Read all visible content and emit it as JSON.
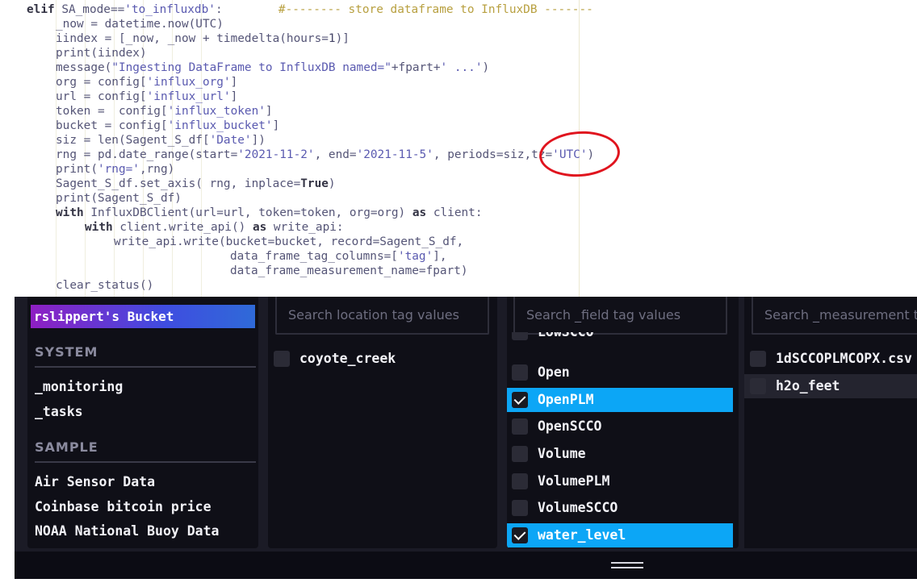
{
  "code": {
    "lines": [
      {
        "indent": 0,
        "parts": [
          {
            "t": "elif",
            "c": "kw"
          },
          {
            "t": " SA_mode==",
            "c": ""
          },
          {
            "t": "'to_influxdb'",
            "c": "str"
          },
          {
            "t": ":        ",
            "c": ""
          },
          {
            "t": "#-------- store dataframe to InfluxDB -------",
            "c": "cmt"
          }
        ]
      },
      {
        "indent": 1,
        "parts": [
          {
            "t": "_now = datetime.now(UTC)",
            "c": ""
          }
        ]
      },
      {
        "indent": 1,
        "parts": [
          {
            "t": "iindex = [_now, _now + timedelta(hours=",
            "c": ""
          },
          {
            "t": "1",
            "c": "num"
          },
          {
            "t": ")]",
            "c": ""
          }
        ]
      },
      {
        "indent": 1,
        "parts": [
          {
            "t": "print(iindex)",
            "c": ""
          }
        ]
      },
      {
        "indent": 1,
        "parts": [
          {
            "t": "message(",
            "c": ""
          },
          {
            "t": "\"Ingesting DataFrame to InfluxDB named=\"",
            "c": "str"
          },
          {
            "t": "+fpart+",
            "c": ""
          },
          {
            "t": "' ...'",
            "c": "str"
          },
          {
            "t": ")",
            "c": ""
          }
        ]
      },
      {
        "indent": 1,
        "parts": [
          {
            "t": "org = config[",
            "c": ""
          },
          {
            "t": "'influx_org'",
            "c": "str"
          },
          {
            "t": "]",
            "c": ""
          }
        ]
      },
      {
        "indent": 1,
        "parts": [
          {
            "t": "url = config[",
            "c": ""
          },
          {
            "t": "'influx_url'",
            "c": "str"
          },
          {
            "t": "]",
            "c": ""
          }
        ]
      },
      {
        "indent": 1,
        "parts": [
          {
            "t": "token =  config[",
            "c": ""
          },
          {
            "t": "'influx_token'",
            "c": "str"
          },
          {
            "t": "]",
            "c": ""
          }
        ]
      },
      {
        "indent": 1,
        "parts": [
          {
            "t": "bucket = config[",
            "c": ""
          },
          {
            "t": "'influx_bucket'",
            "c": "str"
          },
          {
            "t": "]",
            "c": ""
          }
        ]
      },
      {
        "indent": 1,
        "parts": [
          {
            "t": "siz = len(Sagent_S_df[",
            "c": ""
          },
          {
            "t": "'Date'",
            "c": "str"
          },
          {
            "t": "])",
            "c": ""
          }
        ]
      },
      {
        "indent": 1,
        "parts": [
          {
            "t": "rng = pd.date_range(start=",
            "c": ""
          },
          {
            "t": "'2021-11-2'",
            "c": "str"
          },
          {
            "t": ", end=",
            "c": ""
          },
          {
            "t": "'2021-11-5'",
            "c": "str"
          },
          {
            "t": ", periods=siz,tz=",
            "c": ""
          },
          {
            "t": "'UTC'",
            "c": "str"
          },
          {
            "t": ")",
            "c": ""
          }
        ]
      },
      {
        "indent": 1,
        "parts": [
          {
            "t": "print(",
            "c": ""
          },
          {
            "t": "'rng='",
            "c": "str"
          },
          {
            "t": ",rng)",
            "c": ""
          }
        ]
      },
      {
        "indent": 1,
        "parts": [
          {
            "t": "Sagent_S_df.set_axis( rng, inplace=",
            "c": ""
          },
          {
            "t": "True",
            "c": "kw"
          },
          {
            "t": ")",
            "c": ""
          }
        ]
      },
      {
        "indent": 1,
        "parts": [
          {
            "t": "print(Sagent_S_df)",
            "c": ""
          }
        ]
      },
      {
        "indent": 1,
        "parts": [
          {
            "t": "with",
            "c": "kw"
          },
          {
            "t": " InfluxDBClient(url=url, token=token, org=org) ",
            "c": ""
          },
          {
            "t": "as",
            "c": "kw"
          },
          {
            "t": " client:",
            "c": ""
          }
        ]
      },
      {
        "indent": 2,
        "parts": [
          {
            "t": "with",
            "c": "kw"
          },
          {
            "t": " client.write_api() ",
            "c": ""
          },
          {
            "t": "as",
            "c": "kw"
          },
          {
            "t": " write_api:",
            "c": ""
          }
        ]
      },
      {
        "indent": 3,
        "parts": [
          {
            "t": "write_api.write(bucket=bucket, record=Sagent_S_df,",
            "c": ""
          }
        ]
      },
      {
        "indent": 7,
        "parts": [
          {
            "t": "data_frame_tag_columns=[",
            "c": ""
          },
          {
            "t": "'tag'",
            "c": "str"
          },
          {
            "t": "],",
            "c": ""
          }
        ]
      },
      {
        "indent": 7,
        "parts": [
          {
            "t": "data_frame_measurement_name=fpart)",
            "c": ""
          }
        ]
      },
      {
        "indent": 1,
        "parts": [
          {
            "t": "clear_status()",
            "c": ""
          }
        ]
      }
    ]
  },
  "buckets": {
    "selected": "rslippert's Bucket",
    "system_heading": "SYSTEM",
    "system_items": [
      "_monitoring",
      "_tasks"
    ],
    "sample_heading": "SAMPLE",
    "sample_items": [
      "Air Sensor Data",
      "Coinbase bitcoin price",
      "NOAA National Buoy Data"
    ]
  },
  "location": {
    "placeholder": "Search location tag values",
    "values": [
      {
        "label": "coyote_creek",
        "checked": false
      }
    ]
  },
  "field": {
    "placeholder": "Search _field tag values",
    "partial_top": "LowSCCO",
    "values": [
      {
        "label": "Open",
        "checked": false
      },
      {
        "label": "OpenPLM",
        "checked": true
      },
      {
        "label": "OpenSCCO",
        "checked": false
      },
      {
        "label": "Volume",
        "checked": false
      },
      {
        "label": "VolumePLM",
        "checked": false
      },
      {
        "label": "VolumeSCCO",
        "checked": false
      },
      {
        "label": "water_level",
        "checked": true
      }
    ]
  },
  "measurement": {
    "placeholder": "Search _measurement tag values",
    "values": [
      {
        "label": "1dSCCOPLMCOPX.csv",
        "checked": false
      },
      {
        "label": "h2o_feet",
        "checked": false
      }
    ]
  }
}
